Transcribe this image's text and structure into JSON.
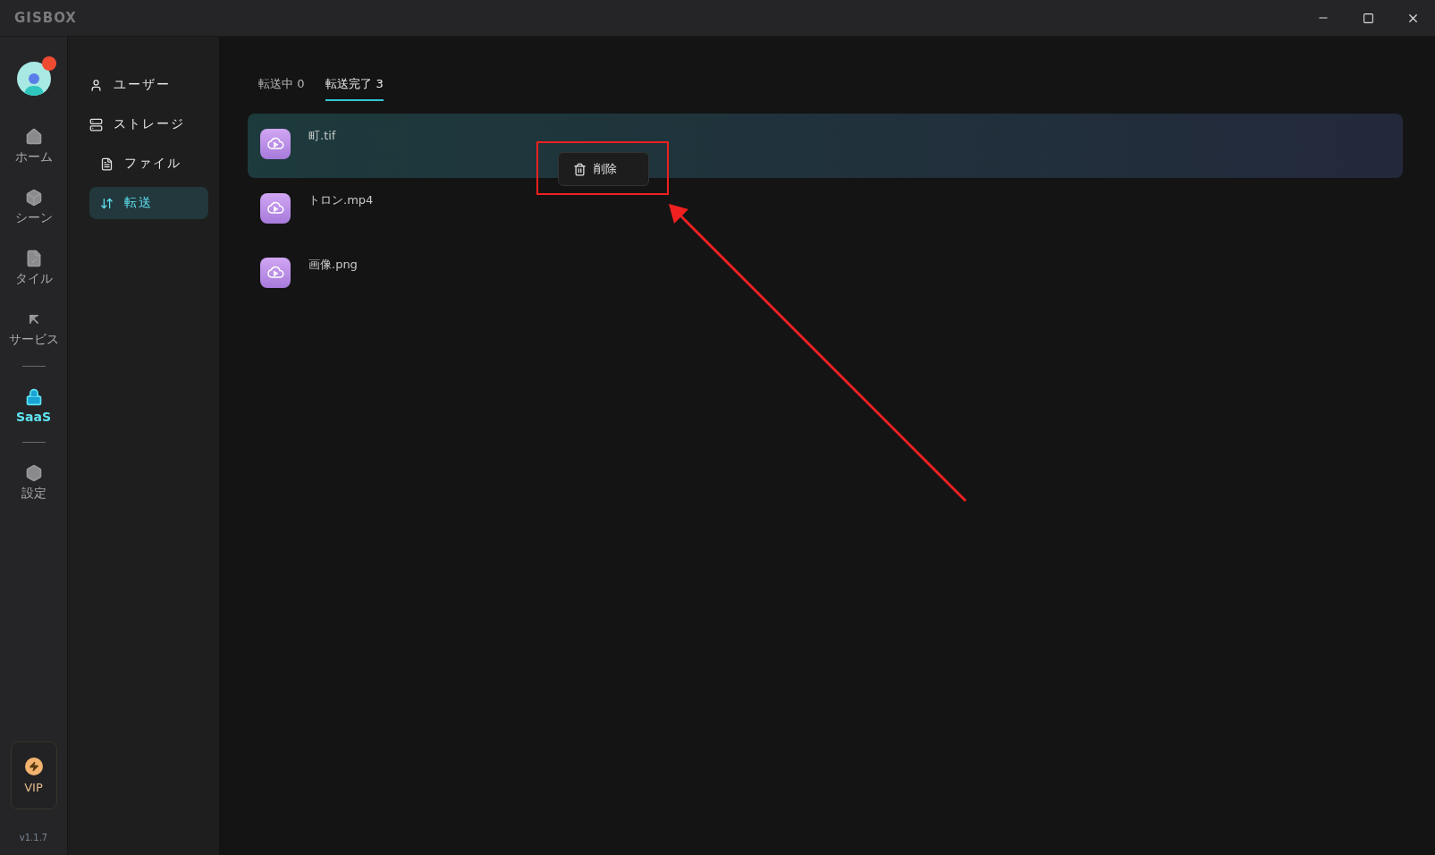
{
  "window": {
    "logo": "GISBOX"
  },
  "rail": {
    "items": [
      {
        "kind": "item",
        "label": "ホーム",
        "selected": false
      },
      {
        "kind": "item",
        "label": "シーン",
        "selected": false
      },
      {
        "kind": "item",
        "label": "タイル",
        "selected": false
      },
      {
        "kind": "item",
        "label": "サービス",
        "selected": false
      },
      {
        "kind": "divider"
      },
      {
        "kind": "item",
        "label": "SaaS",
        "selected": true
      },
      {
        "kind": "divider"
      },
      {
        "kind": "item",
        "label": "設定",
        "selected": false
      }
    ],
    "vip": "VIP",
    "version": "v1.1.7"
  },
  "nav": {
    "items": [
      {
        "label": "ユーザー",
        "selected": false
      },
      {
        "label": "ストレージ",
        "selected": false,
        "children": [
          {
            "label": "ファイル",
            "selected": false
          }
        ]
      },
      {
        "label": "転送",
        "selected": true
      }
    ]
  },
  "tabs": [
    {
      "label": "転送中 0",
      "selected": false
    },
    {
      "label": "転送完了 3",
      "selected": true
    }
  ],
  "files": [
    {
      "name": "町.tif",
      "selected": true
    },
    {
      "name": "トロン.mp4",
      "selected": false
    },
    {
      "name": "画像.png",
      "selected": false
    }
  ],
  "context_menu": {
    "items": [
      "削除"
    ]
  }
}
